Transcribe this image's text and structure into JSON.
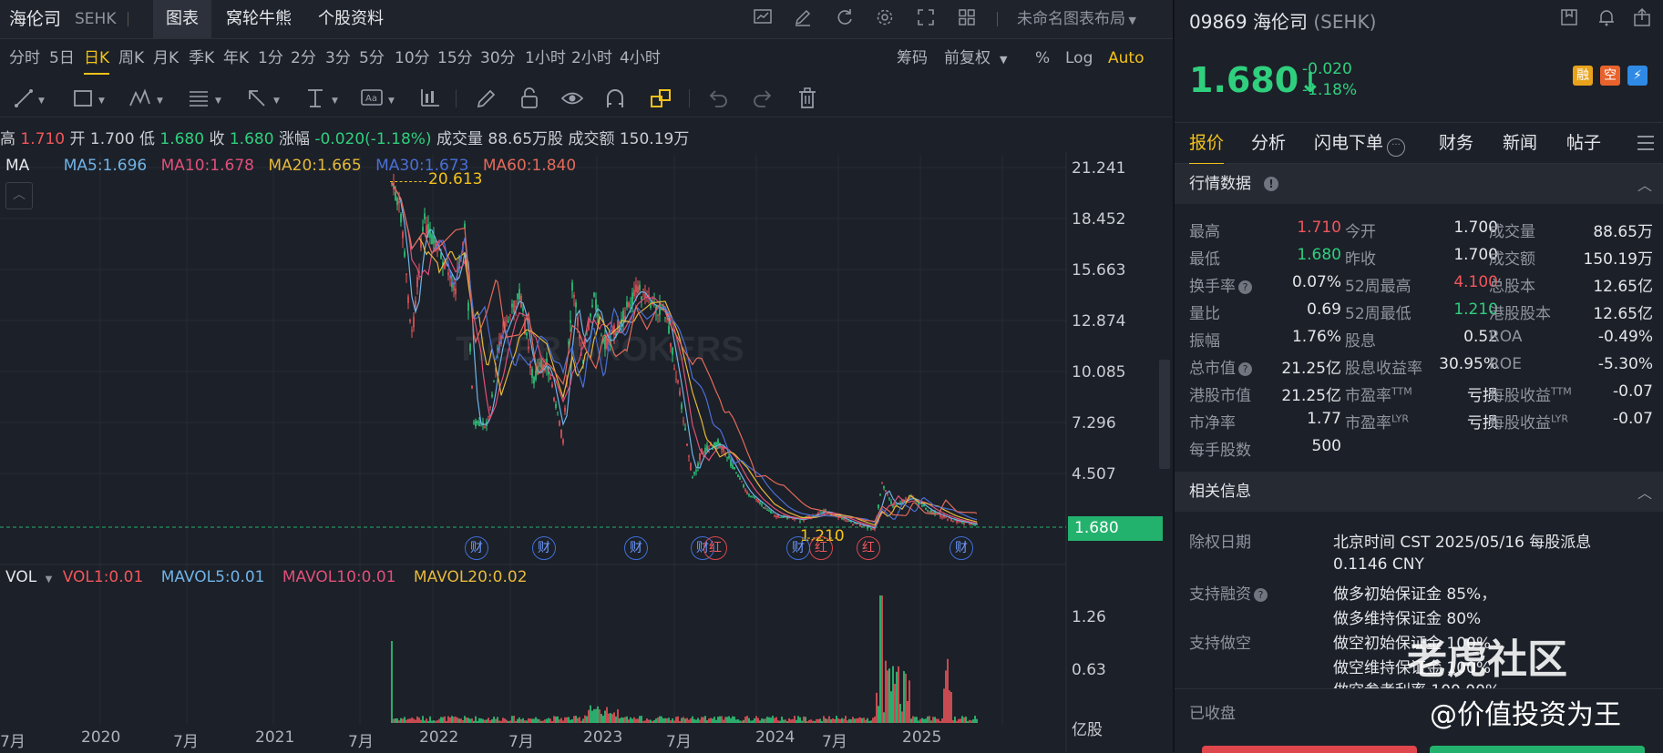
{
  "header": {
    "stock_name": "海伦司",
    "exchange": "SEHK",
    "tabs": [
      "图表",
      "窝轮牛熊",
      "个股资料"
    ],
    "layout_name": "未命名图表布局"
  },
  "periods": [
    "分时",
    "5日",
    "日K",
    "周K",
    "月K",
    "季K",
    "年K",
    "1分",
    "2分",
    "3分",
    "5分",
    "10分",
    "15分",
    "30分",
    "1小时",
    "2小时",
    "4小时"
  ],
  "period_active": "日K",
  "right_controls": {
    "chips": "筹码",
    "adjust": "前复权",
    "percent": "%",
    "log": "Log",
    "auto": "Auto"
  },
  "ohlc": {
    "high_label": "高",
    "high": "1.710",
    "open_label": "开",
    "open": "1.700",
    "low_label": "低",
    "low": "1.680",
    "close_label": "收",
    "close": "1.680",
    "change_label": "涨幅",
    "change": "-0.020(-1.18%)",
    "volume_label": "成交量",
    "volume": "88.65万股",
    "amount_label": "成交额",
    "amount": "150.19万"
  },
  "ma_legend": {
    "title": "MA",
    "items": [
      {
        "text": "MA5:1.696",
        "color": "#6fb3e8"
      },
      {
        "text": "MA10:1.678",
        "color": "#e0507a"
      },
      {
        "text": "MA20:1.665",
        "color": "#e5b93a"
      },
      {
        "text": "MA30:1.673",
        "color": "#4a6fd6"
      },
      {
        "text": "MA60:1.840",
        "color": "#e36a5a"
      }
    ]
  },
  "vol_legend": {
    "title": "VOL",
    "items": [
      {
        "text": "VOL1:0.01",
        "color": "#f0565c"
      },
      {
        "text": "MAVOL5:0.01",
        "color": "#6fb3e8"
      },
      {
        "text": "MAVOL10:0.01",
        "color": "#e0507a"
      },
      {
        "text": "MAVOL20:0.02",
        "color": "#e5b93a"
      }
    ]
  },
  "price_axis": [
    "21.241",
    "18.452",
    "15.663",
    "12.874",
    "10.085",
    "7.296",
    "4.507"
  ],
  "current_price_tag": "1.680",
  "max_annotation": "20.613",
  "min_annotation": "1.210",
  "vol_axis": [
    "1.26",
    "0.63"
  ],
  "vol_unit": "亿股",
  "x_axis": [
    "7月",
    "2020",
    "7月",
    "2021",
    "7月",
    "2022",
    "7月",
    "2023",
    "7月",
    "2024",
    "7月",
    "2025"
  ],
  "watermark": "TIGER BROKERS",
  "event_markers": [
    {
      "text": "财",
      "type": "blue"
    },
    {
      "text": "财",
      "type": "blue"
    },
    {
      "text": "财",
      "type": "blue"
    },
    {
      "text": "财",
      "type": "blue"
    },
    {
      "text": "红",
      "type": "red"
    },
    {
      "text": "财",
      "type": "blue"
    },
    {
      "text": "红",
      "type": "red"
    },
    {
      "text": "红",
      "type": "red"
    },
    {
      "text": "财",
      "type": "blue"
    }
  ],
  "quote": {
    "code": "09869",
    "name": "海伦司",
    "exchange": "(SEHK)",
    "price": "1.680",
    "arrow": "↓",
    "change": "-0.020",
    "change_pct": "-1.18%",
    "badges": [
      {
        "text": "融",
        "color": "#e8a21c"
      },
      {
        "text": "空",
        "color": "#e8622c"
      },
      {
        "text": "⚡",
        "color": "#2f8ae6"
      }
    ]
  },
  "right_tabs": [
    "报价",
    "分析",
    "闪电下单",
    "财务",
    "新闻",
    "帖子"
  ],
  "right_tab_active": "报价",
  "market_data_title": "行情数据",
  "market_rows": [
    [
      "最高",
      "1.710",
      "今开",
      "1.700",
      "成交量",
      "88.65万"
    ],
    [
      "最低",
      "1.680",
      "昨收",
      "1.700",
      "成交额",
      "150.19万"
    ],
    [
      "换手率",
      "0.07%",
      "52周最高",
      "4.100",
      "总股本",
      "12.65亿"
    ],
    [
      "量比",
      "0.69",
      "52周最低",
      "1.210",
      "港股股本",
      "12.65亿"
    ],
    [
      "振幅",
      "1.76%",
      "股息",
      "0.52",
      "ROA",
      "-0.49%"
    ],
    [
      "总市值",
      "21.25亿",
      "股息收益率",
      "30.95%",
      "ROE",
      "-5.30%"
    ],
    [
      "港股市值",
      "21.25亿",
      "市盈率TTM",
      "亏损",
      "每股收益TTM",
      "-0.07"
    ],
    [
      "市净率",
      "1.77",
      "市盈率LYR",
      "亏损",
      "每股收益LYR",
      "-0.07"
    ],
    [
      "每手股数",
      "500",
      "",
      "",
      "",
      ""
    ]
  ],
  "related_title": "相关信息",
  "related": {
    "exdiv_label": "除权日期",
    "exdiv_value_1": "北京时间 CST 2025/05/16 每股派息",
    "exdiv_value_2": "0.1146 CNY",
    "margin_label": "支持融资",
    "margin_1": "做多初始保证金 85%，",
    "margin_2": "做多维持保证金 80%",
    "short_label": "支持做空",
    "short_1": "做空初始保证金 100%",
    "short_2": "做空维持保证金 100%",
    "short_3": "做空参考利率 100.00%"
  },
  "status": "已收盘",
  "overlay_watermark": "老虎社区",
  "overlay_user": "@价值投资为王",
  "colors": {
    "accent": "#f2c21b",
    "up": "#f0565c",
    "down": "#2fcf7e",
    "bg": "#1c2028"
  }
}
